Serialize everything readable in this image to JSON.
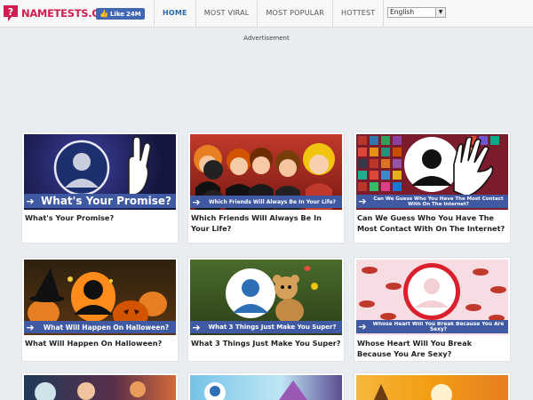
{
  "header": {
    "logo_text": "NAMETESTS.COM",
    "like_label": "Like",
    "like_count": "24M",
    "nav": [
      {
        "label": "HOME",
        "active": true
      },
      {
        "label": "MOST VIRAL"
      },
      {
        "label": "MOST POPULAR"
      },
      {
        "label": "HOTTEST"
      }
    ],
    "language": "English"
  },
  "ad_label": "Advertisement",
  "cards": [
    {
      "title": "What's Your Promise?",
      "banner": "What's Your Promise?"
    },
    {
      "title": "Which Friends Will Always Be In Your Life?",
      "banner": "Which Friends Will Always Be In Your Life?"
    },
    {
      "title": "Can We Guess Who You Have The Most Contact With On The Internet?",
      "banner": "Can We Guess Who You Have The Most Contact With On The Internet?"
    },
    {
      "title": "What Will Happen On Halloween?",
      "banner": "What Will Happen On Halloween?"
    },
    {
      "title": "What 3 Things Just Make You Super?",
      "banner": "What 3 Things Just Make You Super?"
    },
    {
      "title": "Whose Heart Will You Break Because You Are Sexy?",
      "banner": "Whose Heart Will You Break Because You Are Sexy?"
    }
  ],
  "colors": {
    "brand": "#d11c4f",
    "nav_active": "#2a6aa7",
    "banner": "#3f59a3",
    "facebook": "#4267b2",
    "background": "#e9ecf0"
  }
}
